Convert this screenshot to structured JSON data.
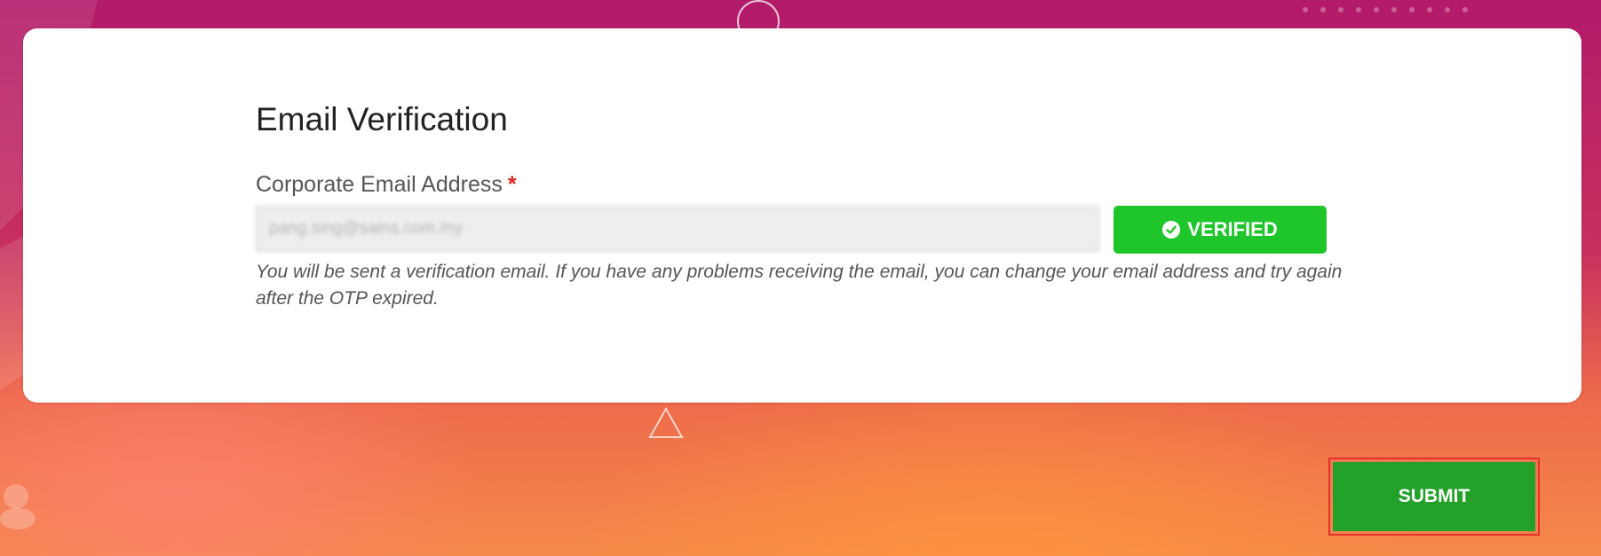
{
  "form": {
    "title": "Email Verification",
    "email_label": "Corporate Email Address",
    "required_mark": "*",
    "email_value": "pang.sing@sains.com.my",
    "verified_label": "VERIFIED",
    "help_text": "You will be sent a verification email. If you have any problems receiving the email, you can change your email address and try again after the OTP expired."
  },
  "actions": {
    "submit_label": "SUBMIT"
  },
  "icons": {
    "verified": "check-circle-icon"
  },
  "colors": {
    "verified_green": "#1ec62b",
    "submit_green": "#24a12a",
    "required_red": "#d9231f",
    "highlight_border": "#e5302f"
  }
}
